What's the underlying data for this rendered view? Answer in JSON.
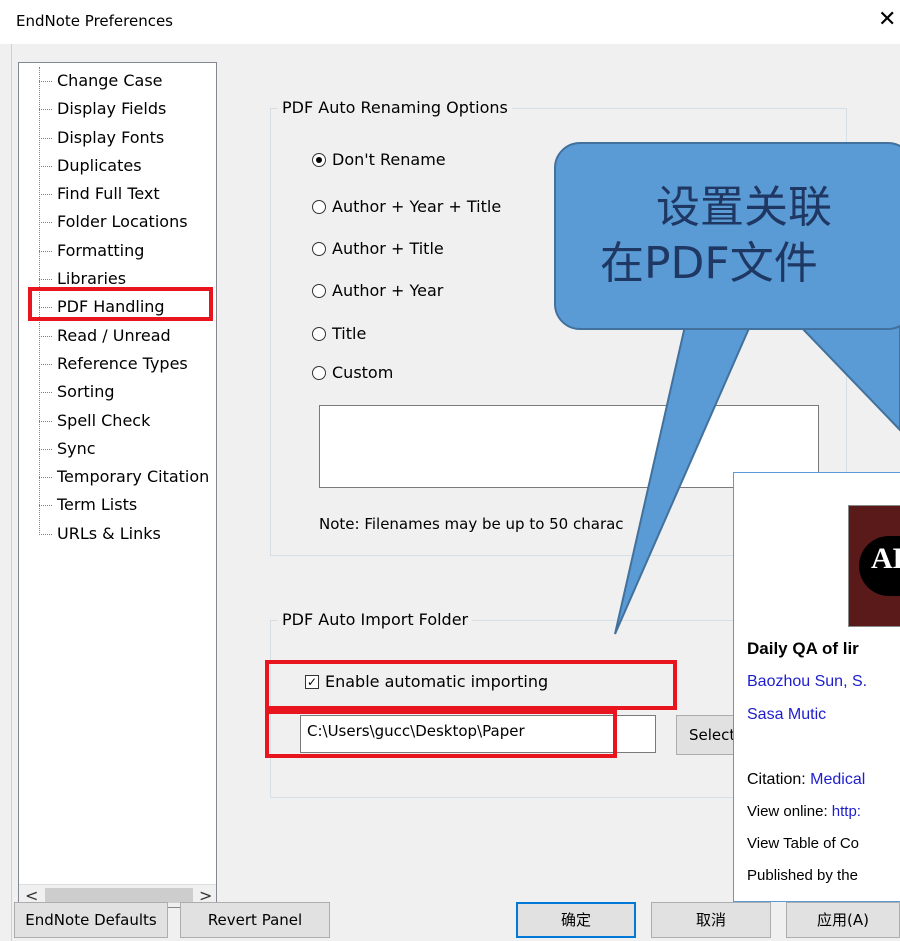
{
  "window": {
    "title": "EndNote Preferences",
    "close_symbol": "✕"
  },
  "sidebar": {
    "items": [
      {
        "label": "Change Case"
      },
      {
        "label": "Display Fields"
      },
      {
        "label": "Display Fonts"
      },
      {
        "label": "Duplicates"
      },
      {
        "label": "Find Full Text"
      },
      {
        "label": "Folder Locations"
      },
      {
        "label": "Formatting"
      },
      {
        "label": "Libraries"
      },
      {
        "label": "PDF Handling"
      },
      {
        "label": "Read / Unread"
      },
      {
        "label": "Reference Types"
      },
      {
        "label": "Sorting"
      },
      {
        "label": "Spell Check"
      },
      {
        "label": "Sync"
      },
      {
        "label": "Temporary Citation"
      },
      {
        "label": "Term Lists"
      },
      {
        "label": "URLs & Links"
      }
    ],
    "selected": "PDF Handling",
    "scroll_left": "<",
    "scroll_right": ">"
  },
  "renaming": {
    "group_label": "PDF Auto Renaming Options",
    "options": [
      {
        "label": "Don't Rename",
        "checked": true
      },
      {
        "label": "Author + Year + Title",
        "checked": false
      },
      {
        "label": "Author + Title",
        "checked": false
      },
      {
        "label": "Author + Year",
        "checked": false
      },
      {
        "label": "Title",
        "checked": false
      },
      {
        "label": "Custom",
        "checked": false
      }
    ],
    "note": "Note: Filenames may be up to 50 charac"
  },
  "import": {
    "group_label": "PDF Auto Import Folder",
    "enable_label": "Enable automatic importing",
    "enable_checked": true,
    "folder_path": "C:\\Users\\gucc\\Desktop\\Paper",
    "select_label": "Select"
  },
  "callout": {
    "line1": "设置关联",
    "line2": "在PDF文件"
  },
  "pdf_preview": {
    "logo_text": "AP",
    "title": "Daily QA of lir",
    "authors_line1": "Baozhou Sun, S.",
    "authors_line2": "Sasa Mutic",
    "citation_label": "Citation: ",
    "citation_value": "Medical",
    "view_online_label": "View online: ",
    "view_online_value": "http:",
    "toc": "View Table of Co",
    "published": "Published by the"
  },
  "footer": {
    "defaults": "EndNote Defaults",
    "revert": "Revert Panel",
    "ok": "确定",
    "cancel": "取消",
    "apply": "应用(A)"
  },
  "colors": {
    "highlight": "#e8141e",
    "callout": "#5b9bd5",
    "accent": "#0078d7"
  }
}
